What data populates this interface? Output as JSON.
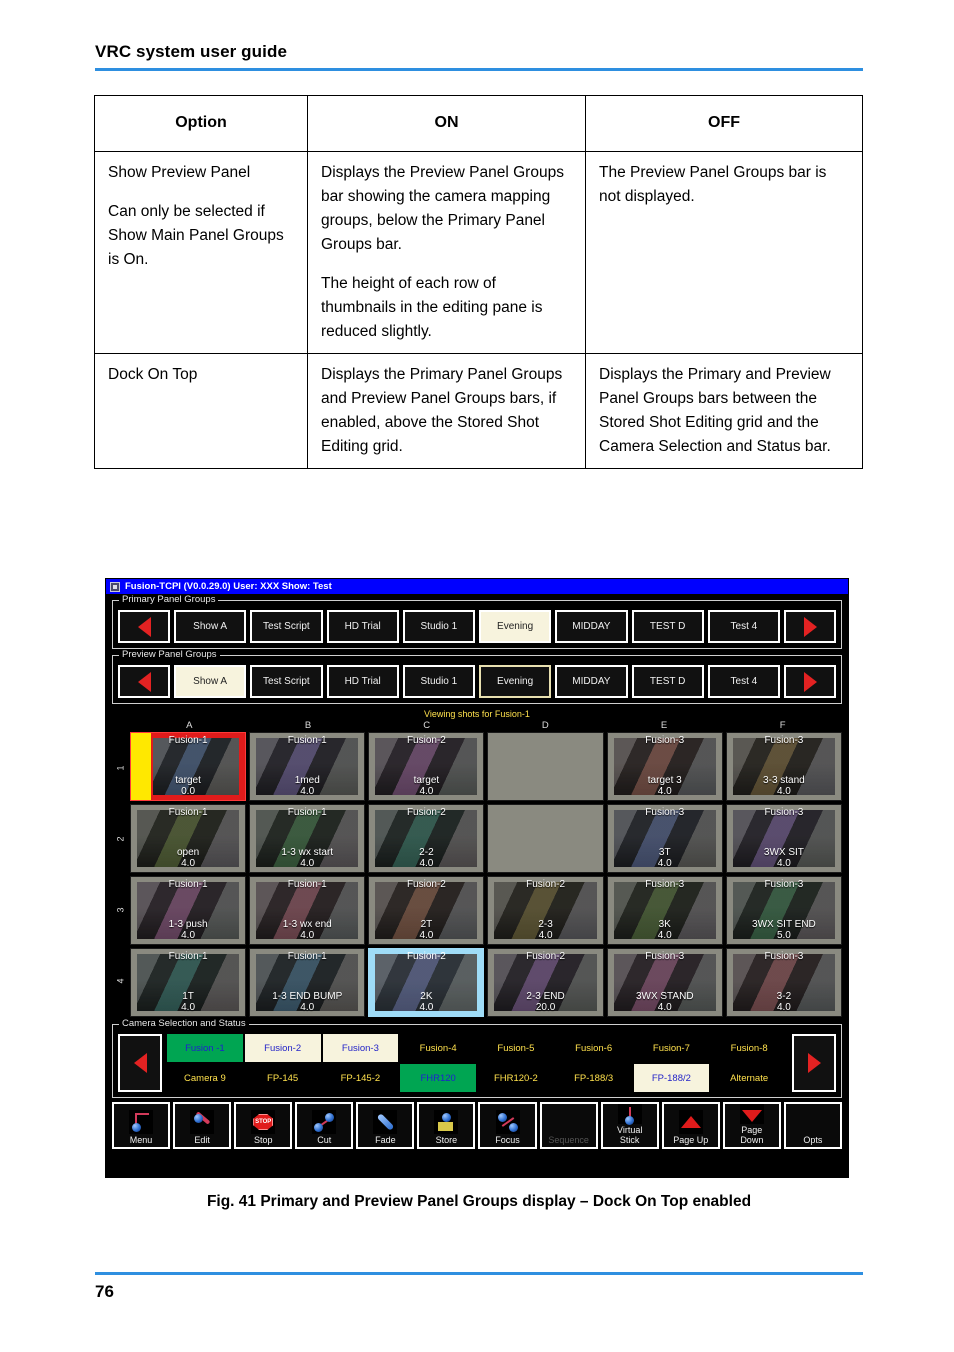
{
  "document": {
    "header_title": "VRC system user guide",
    "page_number": "76",
    "figure_caption": "Fig. 41  Primary and Preview Panel Groups display – Dock On Top enabled"
  },
  "options_table": {
    "headers": [
      "Option",
      "ON",
      "OFF"
    ],
    "rows": [
      {
        "option": [
          "Show Preview Panel",
          "Can only be selected if Show Main Panel Groups is On."
        ],
        "on": [
          "Displays the Preview Panel Groups bar showing the camera mapping groups, below the Primary Panel Groups bar.",
          "The height of each row of thumbnails in the editing pane is reduced slightly."
        ],
        "off": [
          "The Preview Panel Groups bar is not displayed."
        ]
      },
      {
        "option": [
          "Dock On Top"
        ],
        "on": [
          "Displays the Primary Panel Groups and Preview Panel Groups bars, if enabled, above the Stored Shot Editing grid."
        ],
        "off": [
          "Displays the Primary and Preview Panel Groups bars between the Stored Shot Editing grid and the Camera Selection and Status bar."
        ]
      }
    ]
  },
  "app": {
    "titlebar": "Fusion-TCPI (V0.0.29.0)  User: XXX  Show: Test",
    "primary_panel_groups": {
      "legend": "Primary Panel Groups",
      "buttons": [
        {
          "label": "Show A",
          "state": "normal"
        },
        {
          "label": "Test Script",
          "state": "normal"
        },
        {
          "label": "HD Trial",
          "state": "normal"
        },
        {
          "label": "Studio 1",
          "state": "normal"
        },
        {
          "label": "Evening",
          "state": "selected"
        },
        {
          "label": "MIDDAY",
          "state": "normal"
        },
        {
          "label": "TEST D",
          "state": "normal"
        },
        {
          "label": "Test 4",
          "state": "normal"
        }
      ]
    },
    "preview_panel_groups": {
      "legend": "Preview Panel Groups",
      "buttons": [
        {
          "label": "Show A",
          "state": "selected"
        },
        {
          "label": "Test Script",
          "state": "normal"
        },
        {
          "label": "HD Trial",
          "state": "normal"
        },
        {
          "label": "Studio 1",
          "state": "normal"
        },
        {
          "label": "Evening",
          "state": "outlined"
        },
        {
          "label": "MIDDAY",
          "state": "normal"
        },
        {
          "label": "TEST D",
          "state": "normal"
        },
        {
          "label": "Test 4",
          "state": "normal"
        }
      ]
    },
    "grid": {
      "viewing_label": "Viewing shots for Fusion-1",
      "column_headers": [
        "A",
        "B",
        "C",
        "D",
        "E",
        "F"
      ],
      "row_labels": [
        "1",
        "2",
        "3",
        "4"
      ],
      "cells": [
        {
          "camera": "Fusion-1",
          "name": "target",
          "duration": "0.0",
          "highlight": "red"
        },
        {
          "camera": "Fusion-1",
          "name": "1med",
          "duration": "4.0",
          "highlight": "none"
        },
        {
          "camera": "Fusion-2",
          "name": "target",
          "duration": "4.0",
          "highlight": "none"
        },
        {
          "camera": "",
          "name": "",
          "duration": "",
          "highlight": "empty"
        },
        {
          "camera": "Fusion-3",
          "name": "target 3",
          "duration": "4.0",
          "highlight": "none"
        },
        {
          "camera": "Fusion-3",
          "name": "3-3 stand",
          "duration": "4.0",
          "highlight": "none"
        },
        {
          "camera": "Fusion-1",
          "name": "open",
          "duration": "4.0",
          "highlight": "none"
        },
        {
          "camera": "Fusion-1",
          "name": "1-3 wx start",
          "duration": "4.0",
          "highlight": "none"
        },
        {
          "camera": "Fusion-2",
          "name": "2-2",
          "duration": "4.0",
          "highlight": "none"
        },
        {
          "camera": "",
          "name": "",
          "duration": "",
          "highlight": "empty"
        },
        {
          "camera": "Fusion-3",
          "name": "3T",
          "duration": "4.0",
          "highlight": "none"
        },
        {
          "camera": "Fusion-3",
          "name": "3WX SIT",
          "duration": "4.0",
          "highlight": "none"
        },
        {
          "camera": "Fusion-1",
          "name": "1-3 push",
          "duration": "4.0",
          "highlight": "none"
        },
        {
          "camera": "Fusion-1",
          "name": "1-3 wx end",
          "duration": "4.0",
          "highlight": "none"
        },
        {
          "camera": "Fusion-2",
          "name": "2T",
          "duration": "4.0",
          "highlight": "none"
        },
        {
          "camera": "Fusion-2",
          "name": "2-3",
          "duration": "4.0",
          "highlight": "none"
        },
        {
          "camera": "Fusion-3",
          "name": "3K",
          "duration": "4.0",
          "highlight": "none"
        },
        {
          "camera": "Fusion-3",
          "name": "3WX SIT END",
          "duration": "5.0",
          "highlight": "none"
        },
        {
          "camera": "Fusion-1",
          "name": "1T",
          "duration": "4.0",
          "highlight": "none"
        },
        {
          "camera": "Fusion-1",
          "name": "1-3 END BUMP",
          "duration": "4.0",
          "highlight": "none"
        },
        {
          "camera": "Fusion-2",
          "name": "2K",
          "duration": "4.0",
          "highlight": "blue"
        },
        {
          "camera": "Fusion-2",
          "name": "2-3 END",
          "duration": "20.0",
          "highlight": "none"
        },
        {
          "camera": "Fusion-3",
          "name": "3WX STAND",
          "duration": "4.0",
          "highlight": "none"
        },
        {
          "camera": "Fusion-3",
          "name": "3-2",
          "duration": "4.0",
          "highlight": "none"
        }
      ]
    },
    "camera_selection": {
      "legend": "Camera Selection and Status",
      "cells": [
        {
          "label": "Fusion -1",
          "state": "green"
        },
        {
          "label": "Fusion-2",
          "state": "cream"
        },
        {
          "label": "Fusion-3",
          "state": "cream"
        },
        {
          "label": "Fusion-4",
          "state": "plain"
        },
        {
          "label": "Fusion-5",
          "state": "plain"
        },
        {
          "label": "Fusion-6",
          "state": "plain"
        },
        {
          "label": "Fusion-7",
          "state": "plain"
        },
        {
          "label": "Fusion-8",
          "state": "plain"
        },
        {
          "label": "Camera 9",
          "state": "plain"
        },
        {
          "label": "FP-145",
          "state": "plain"
        },
        {
          "label": "FP-145-2",
          "state": "plain"
        },
        {
          "label": "FHR120",
          "state": "green"
        },
        {
          "label": "FHR120-2",
          "state": "plain"
        },
        {
          "label": "FP-188/3",
          "state": "plain"
        },
        {
          "label": "FP-188/2",
          "state": "cream"
        },
        {
          "label": "Alternate",
          "state": "plain"
        }
      ]
    },
    "toolbar": [
      {
        "label": "Menu",
        "icon": "menu-icon",
        "enabled": true
      },
      {
        "label": "Edit",
        "icon": "wrench-icon",
        "enabled": true
      },
      {
        "label": "Stop",
        "icon": "stop-icon",
        "enabled": true
      },
      {
        "label": "Cut",
        "icon": "cut-icon",
        "enabled": true
      },
      {
        "label": "Fade",
        "icon": "fade-icon",
        "enabled": true
      },
      {
        "label": "Store",
        "icon": "store-icon",
        "enabled": true
      },
      {
        "label": "Focus",
        "icon": "focus-icon",
        "enabled": true
      },
      {
        "label": "Sequence",
        "icon": "none",
        "enabled": false
      },
      {
        "label": "Virtual\nStick",
        "icon": "virtual-stick-icon",
        "enabled": true
      },
      {
        "label": "Page Up",
        "icon": "arrow-up-icon",
        "enabled": true
      },
      {
        "label": "Page\nDown",
        "icon": "arrow-down-icon",
        "enabled": true
      },
      {
        "label": "Opts",
        "icon": "none",
        "enabled": true
      }
    ],
    "colors": {
      "titlebar_bg": "#0000ff",
      "selected_group": "#f7f3dd",
      "highlight_red": "#e01b1b",
      "highlight_yellow": "#ffe800",
      "highlight_blue": "#9fdcf7",
      "status_green": "#00a552",
      "label_yellow": "#ffe14d",
      "arrow_red": "#e32222"
    }
  }
}
